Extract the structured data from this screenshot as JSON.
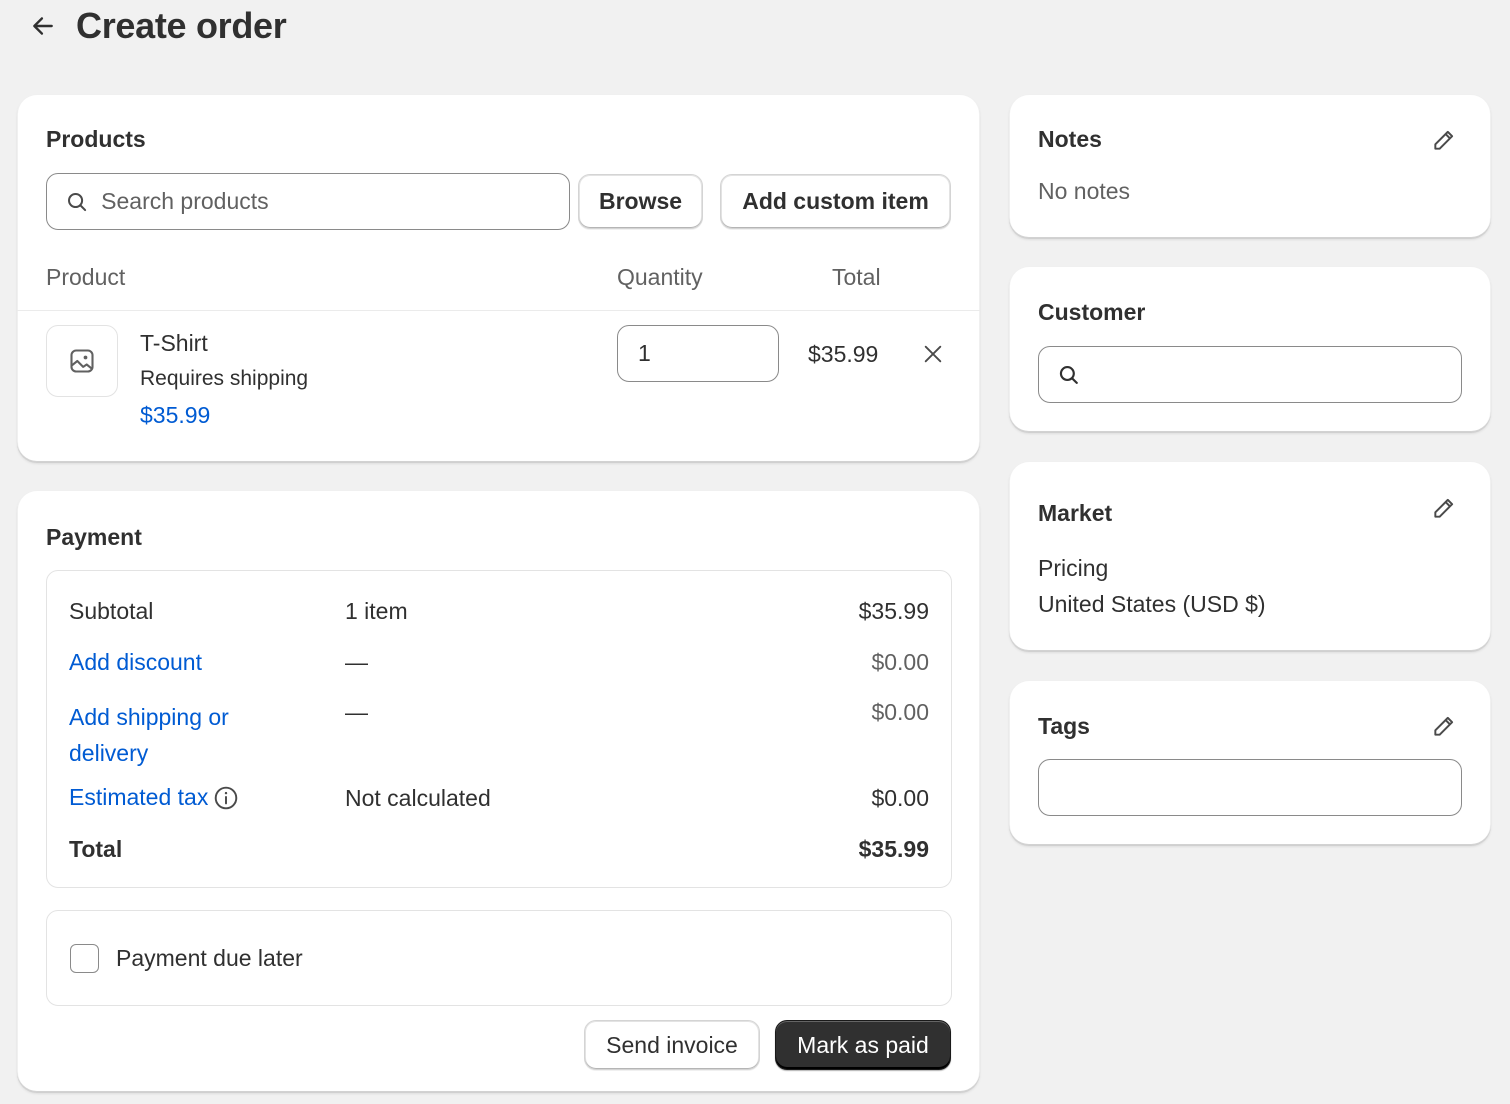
{
  "header": {
    "title": "Create order"
  },
  "products": {
    "title": "Products",
    "search_placeholder": "Search products",
    "browse_label": "Browse",
    "add_custom_label": "Add custom item",
    "columns": {
      "product": "Product",
      "quantity": "Quantity",
      "total": "Total"
    },
    "items": [
      {
        "name": "T-Shirt",
        "shipping": "Requires shipping",
        "price": "$35.99",
        "quantity": "1",
        "total": "$35.99"
      }
    ]
  },
  "payment": {
    "title": "Payment",
    "rows": {
      "subtotal": {
        "label": "Subtotal",
        "middle": "1 item",
        "amount": "$35.99"
      },
      "discount": {
        "label": "Add discount",
        "middle": "—",
        "amount": "$0.00"
      },
      "shipping": {
        "label_line1": "Add shipping or",
        "label_line2": "delivery",
        "middle": "—",
        "amount": "$0.00"
      },
      "tax": {
        "label": "Estimated tax",
        "middle": "Not calculated",
        "amount": "$0.00"
      },
      "total": {
        "label": "Total",
        "amount": "$35.99"
      }
    },
    "due_later_label": "Payment due later",
    "send_invoice_label": "Send invoice",
    "mark_paid_label": "Mark as paid"
  },
  "notes": {
    "title": "Notes",
    "body": "No notes"
  },
  "customer": {
    "title": "Customer",
    "search_value": ""
  },
  "market": {
    "title": "Market",
    "pricing_label": "Pricing",
    "pricing_value": "United States (USD $)"
  },
  "tags": {
    "title": "Tags",
    "value": ""
  },
  "colors": {
    "link": "#005bd3",
    "primary_button": "#303030",
    "background": "#f1f1f1"
  },
  "icons": [
    "arrow-left-icon",
    "search-icon",
    "image-placeholder-icon",
    "close-icon",
    "info-icon",
    "pencil-icon"
  ]
}
